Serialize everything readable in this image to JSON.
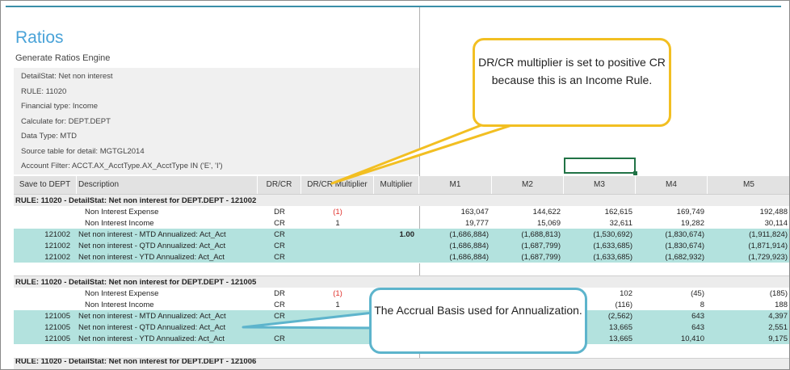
{
  "page": {
    "title": "Ratios",
    "subtitle": "Generate Ratios Engine"
  },
  "info": {
    "lines": [
      "DetailStat: Net non interest",
      "RULE: 11020",
      "Financial type: Income",
      "Calculate for: DEPT.DEPT",
      "Data Type: MTD",
      "Source table for detail: MGTGL2014",
      "Account Filter: ACCT.AX_AcctType.AX_AcctType IN ('E', 'I')"
    ]
  },
  "table": {
    "headers": [
      "Save to DEPT",
      "Description",
      "DR/CR",
      "DR/CR Multiplier",
      "Multiplier",
      "M1",
      "M2",
      "M3",
      "M4",
      "M5"
    ],
    "groups": [
      {
        "title": "RULE: 11020 - DetailStat: Net non interest for DEPT.DEPT - 121002",
        "rows": [
          {
            "style": "plain",
            "dept": "",
            "desc": "Non Interest Expense",
            "drcr": "DR",
            "mult": "(1)",
            "mult_red": true,
            "multiplier": "",
            "m": [
              "163,047",
              "144,622",
              "162,615",
              "169,749",
              "192,488"
            ]
          },
          {
            "style": "plain",
            "dept": "",
            "desc": "Non Interest Income",
            "drcr": "CR",
            "mult": "1",
            "mult_red": false,
            "multiplier": "",
            "m": [
              "19,777",
              "15,069",
              "32,611",
              "19,282",
              "30,114"
            ]
          },
          {
            "style": "teal",
            "dept": "121002",
            "desc": "Net non interest - MTD Annualized: Act_Act",
            "drcr": "CR",
            "mult": "",
            "mult_red": false,
            "multiplier": "1.00",
            "m": [
              "(1,686,884)",
              "(1,688,813)",
              "(1,530,692)",
              "(1,830,674)",
              "(1,911,824)"
            ]
          },
          {
            "style": "teal",
            "dept": "121002",
            "desc": "Net non interest - QTD Annualized: Act_Act",
            "drcr": "CR",
            "mult": "",
            "mult_red": false,
            "multiplier": "",
            "m": [
              "(1,686,884)",
              "(1,687,799)",
              "(1,633,685)",
              "(1,830,674)",
              "(1,871,914)"
            ]
          },
          {
            "style": "teal",
            "dept": "121002",
            "desc": "Net non interest - YTD Annualized: Act_Act",
            "drcr": "CR",
            "mult": "",
            "mult_red": false,
            "multiplier": "",
            "m": [
              "(1,686,884)",
              "(1,687,799)",
              "(1,633,685)",
              "(1,682,932)",
              "(1,729,923)"
            ]
          }
        ]
      },
      {
        "title": "RULE: 11020 - DetailStat: Net non interest for DEPT.DEPT - 121005",
        "rows": [
          {
            "style": "plain",
            "dept": "",
            "desc": "Non Interest Expense",
            "drcr": "DR",
            "mult": "(1)",
            "mult_red": true,
            "multiplier": "",
            "m": [
              "",
              "",
              "102",
              "(45)",
              "(185)"
            ]
          },
          {
            "style": "plain",
            "dept": "",
            "desc": "Non Interest Income",
            "drcr": "CR",
            "mult": "1",
            "mult_red": false,
            "multiplier": "",
            "m": [
              "",
              "",
              "(116)",
              "8",
              "188"
            ]
          },
          {
            "style": "teal",
            "dept": "121005",
            "desc": "Net non interest - MTD Annualized: Act_Act",
            "drcr": "CR",
            "mult": "",
            "mult_red": false,
            "multiplier": "",
            "m": [
              "",
              "",
              "(2,562)",
              "643",
              "4,397"
            ]
          },
          {
            "style": "teal",
            "dept": "121005",
            "desc": "Net non interest - QTD Annualized: Act_Act",
            "drcr": "",
            "mult": "",
            "mult_red": false,
            "multiplier": "",
            "m": [
              "",
              "",
              "13,665",
              "643",
              "2,551"
            ]
          },
          {
            "style": "teal",
            "dept": "121005",
            "desc": "Net non interest - YTD Annualized: Act_Act",
            "drcr": "CR",
            "mult": "",
            "mult_red": false,
            "multiplier": "",
            "m": [
              "",
              "",
              "13,665",
              "10,410",
              "9,175"
            ]
          }
        ]
      }
    ],
    "partial_group_title": "RULE: 11020 - DetailStat: Net non interest for DEPT.DEPT - 121006"
  },
  "callouts": {
    "drcr_note": "DR/CR multiplier is set to positive CR because this is an Income Rule.",
    "accrual_note": "The Accrual Basis used for Annualization."
  },
  "colors": {
    "title": "#4aa3d8",
    "teal_row": "#b3e2de",
    "callout1_border": "#f2bf22",
    "callout2_border": "#5db4cc",
    "negative": "#e0302b",
    "selection": "#217346"
  }
}
